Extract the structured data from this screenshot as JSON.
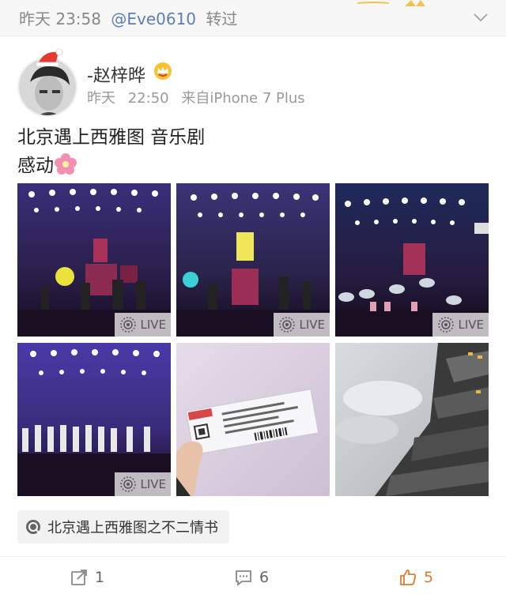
{
  "repost": {
    "date": "昨天",
    "time": "23:58",
    "handle": "@Eve0610",
    "action": "转过"
  },
  "post": {
    "username": "-赵梓晔",
    "date": "昨天",
    "time": "22:50",
    "source": "来自iPhone 7 Plus",
    "content_line1": "北京遇上西雅图 音乐剧",
    "content_line2": "感动"
  },
  "photos": [
    {
      "type": "stage",
      "live_label": "LIVE"
    },
    {
      "type": "stage",
      "live_label": "LIVE"
    },
    {
      "type": "stage",
      "live_label": "LIVE"
    },
    {
      "type": "stage",
      "live_label": "LIVE"
    },
    {
      "type": "ticket"
    },
    {
      "type": "sky"
    }
  ],
  "topic": {
    "label": "北京遇上西雅图之不二情书",
    "icon": "location-icon"
  },
  "actions": {
    "repost_count": "1",
    "comment_count": "6",
    "like_count": "5"
  },
  "colors": {
    "handle": "#5b7fb0",
    "like": "#e07a2a",
    "meta": "#999999"
  }
}
